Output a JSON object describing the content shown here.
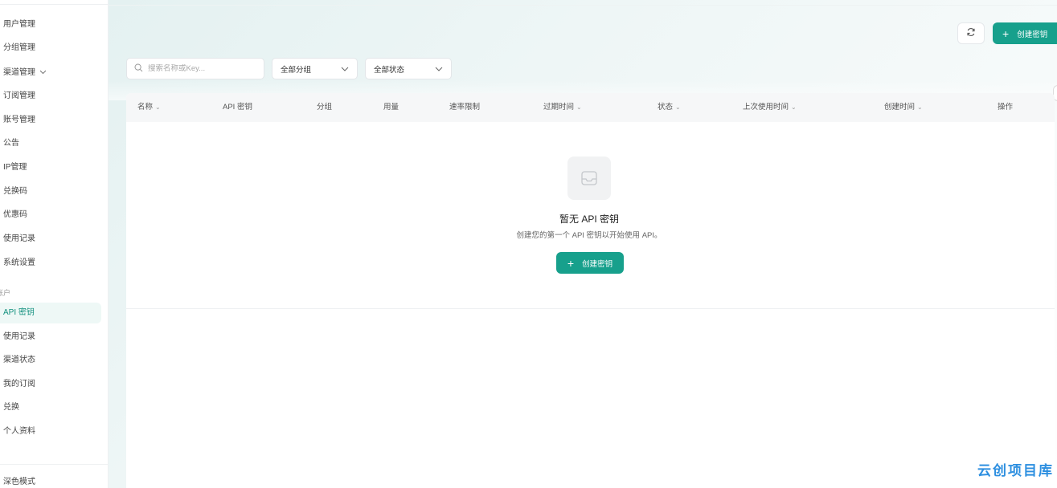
{
  "sidebar": {
    "items_top": [
      {
        "label": "用户管理"
      },
      {
        "label": "分组管理"
      },
      {
        "label": "渠道管理",
        "has_chevron": true
      },
      {
        "label": "订阅管理"
      },
      {
        "label": "账号管理"
      },
      {
        "label": "公告"
      },
      {
        "label": "IP管理"
      },
      {
        "label": "兑换码"
      },
      {
        "label": "优惠码"
      },
      {
        "label": "使用记录"
      },
      {
        "label": "系统设置"
      }
    ],
    "section_label": "账户",
    "items_user": [
      {
        "label": "API 密钥",
        "active": true
      },
      {
        "label": "使用记录"
      },
      {
        "label": "渠道状态"
      },
      {
        "label": "我的订阅"
      },
      {
        "label": "兑换"
      },
      {
        "label": "个人资料"
      }
    ],
    "dark_mode_label": "深色模式",
    "chevron_icon": "chevron-down-icon"
  },
  "toolbar": {
    "refresh_icon": "refresh-icon",
    "create_label": "创建密钥"
  },
  "filters": {
    "search_placeholder": "搜索名称或Key...",
    "search_value": "",
    "group_select": "全部分组",
    "status_select": "全部状态"
  },
  "table": {
    "columns": [
      {
        "label": "名称",
        "sortable": true
      },
      {
        "label": "API 密钥",
        "sortable": false
      },
      {
        "label": "分组",
        "sortable": false
      },
      {
        "label": "用量",
        "sortable": false
      },
      {
        "label": "速率限制",
        "sortable": false
      },
      {
        "label": "过期时间",
        "sortable": true
      },
      {
        "label": "状态",
        "sortable": true
      },
      {
        "label": "上次使用时间",
        "sortable": true
      },
      {
        "label": "创建时间",
        "sortable": true
      },
      {
        "label": "操作",
        "sortable": false
      }
    ],
    "rows": []
  },
  "empty_state": {
    "icon": "inbox-icon",
    "title": "暂无 API 密钥",
    "description": "创建您的第一个 API 密钥以开始使用 API。",
    "button_label": "创建密钥"
  },
  "watermark": "云创项目库",
  "colors": {
    "accent": "#17a08c",
    "active_bg": "#eef8f6",
    "active_text": "#12907e"
  }
}
